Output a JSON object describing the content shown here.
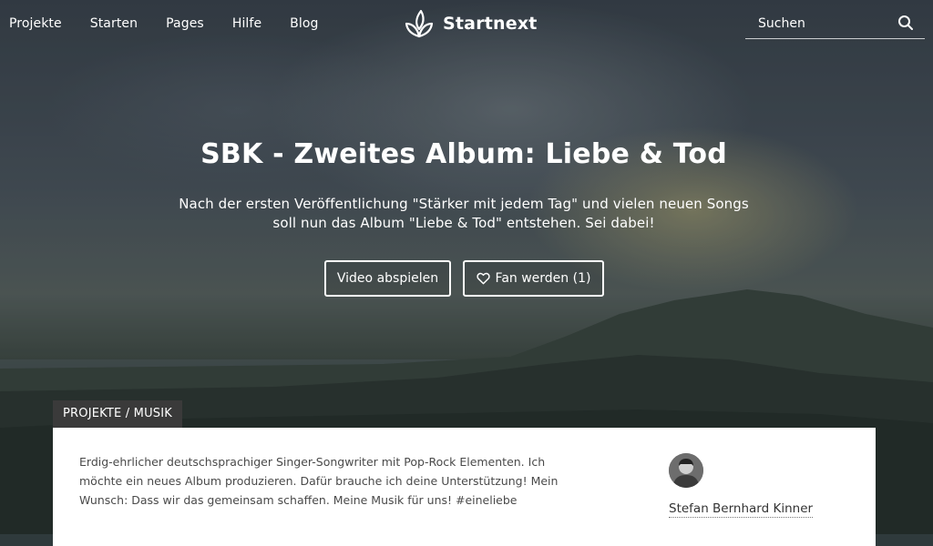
{
  "nav": {
    "links": [
      "Projekte",
      "Starten",
      "Pages",
      "Hilfe",
      "Blog"
    ],
    "logo_text": "Startnext",
    "search_placeholder": "Suchen"
  },
  "hero": {
    "title": "SBK - Zweites Album: Liebe & Tod",
    "subtitle": "Nach der ersten Veröffentlichung \"Stärker mit jedem Tag\" und vielen neuen Songs soll nun das Album \"Liebe & Tod\" entstehen. Sei dabei!",
    "video_button": "Video abspielen",
    "fan_button": "Fan werden (1)"
  },
  "category": "PROJEKTE / MUSIK",
  "project": {
    "description": "Erdig-ehrlicher deutschsprachiger Singer-Songwriter mit Pop-Rock Elementen. Ich möchte ein neues Album produzieren. Dafür brauche ich deine Unterstützung! Mein Wunsch: Dass wir das gemeinsam schaffen. Meine Musik für uns! #eineliebe",
    "creator_name": "Stefan Bernhard Kinner"
  },
  "icons": {
    "logo": "leaf-logo-icon",
    "search": "search-icon",
    "fan": "heart-icon"
  }
}
